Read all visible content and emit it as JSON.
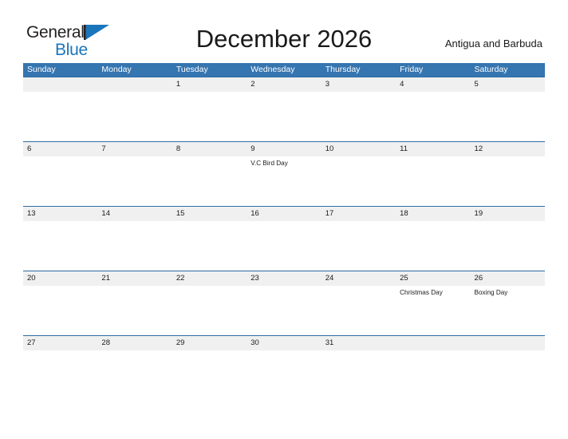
{
  "brand": {
    "name_part1": "General",
    "name_part2": "Blue",
    "flag_color": "#1b75bb",
    "text_color": "#231f20"
  },
  "header": {
    "title": "December 2026",
    "region": "Antigua and Barbuda"
  },
  "colors": {
    "header_blue": "#3575b0",
    "row_rule_blue": "#2e6da4",
    "band_gray": "#f0f0f0",
    "text_dark": "#1a1a1a",
    "page_background": "#ffffff"
  },
  "calendar": {
    "month": "December",
    "year": "2026",
    "weekday_headers": [
      "Sunday",
      "Monday",
      "Tuesday",
      "Wednesday",
      "Thursday",
      "Friday",
      "Saturday"
    ],
    "weeks": [
      [
        {
          "date": "",
          "event": ""
        },
        {
          "date": "",
          "event": ""
        },
        {
          "date": "1",
          "event": ""
        },
        {
          "date": "2",
          "event": ""
        },
        {
          "date": "3",
          "event": ""
        },
        {
          "date": "4",
          "event": ""
        },
        {
          "date": "5",
          "event": ""
        }
      ],
      [
        {
          "date": "6",
          "event": ""
        },
        {
          "date": "7",
          "event": ""
        },
        {
          "date": "8",
          "event": ""
        },
        {
          "date": "9",
          "event": "V.C Bird Day"
        },
        {
          "date": "10",
          "event": ""
        },
        {
          "date": "11",
          "event": ""
        },
        {
          "date": "12",
          "event": ""
        }
      ],
      [
        {
          "date": "13",
          "event": ""
        },
        {
          "date": "14",
          "event": ""
        },
        {
          "date": "15",
          "event": ""
        },
        {
          "date": "16",
          "event": ""
        },
        {
          "date": "17",
          "event": ""
        },
        {
          "date": "18",
          "event": ""
        },
        {
          "date": "19",
          "event": ""
        }
      ],
      [
        {
          "date": "20",
          "event": ""
        },
        {
          "date": "21",
          "event": ""
        },
        {
          "date": "22",
          "event": ""
        },
        {
          "date": "23",
          "event": ""
        },
        {
          "date": "24",
          "event": ""
        },
        {
          "date": "25",
          "event": "Christmas Day"
        },
        {
          "date": "26",
          "event": "Boxing Day"
        }
      ],
      [
        {
          "date": "27",
          "event": ""
        },
        {
          "date": "28",
          "event": ""
        },
        {
          "date": "29",
          "event": ""
        },
        {
          "date": "30",
          "event": ""
        },
        {
          "date": "31",
          "event": ""
        },
        {
          "date": "",
          "event": ""
        },
        {
          "date": "",
          "event": ""
        }
      ]
    ]
  }
}
